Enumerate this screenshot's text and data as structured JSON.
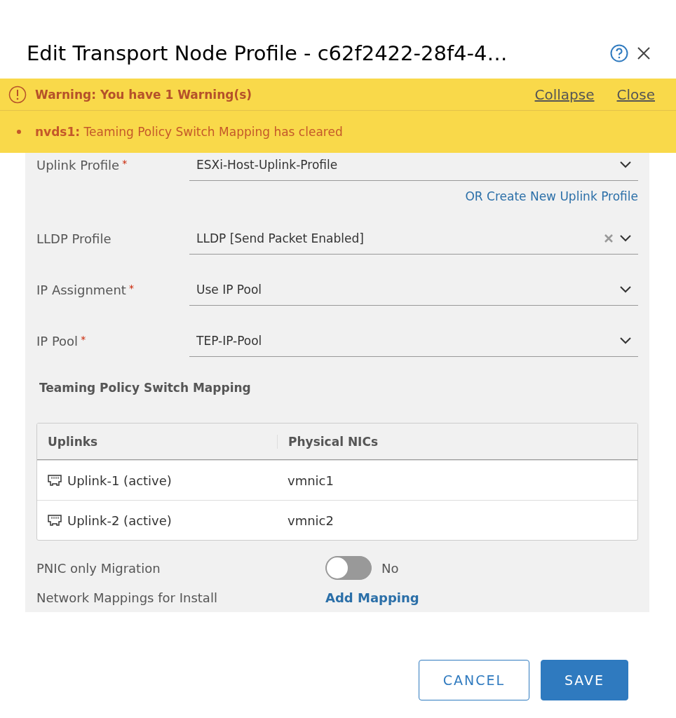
{
  "window": {
    "title": "Edit Transport Node Profile - c62f2422-28f4-4…"
  },
  "warning": {
    "title": "Warning: You have 1 Warning(s)",
    "actions": [
      "Collapse",
      "Close"
    ],
    "items": [
      {
        "source": "nvds1:",
        "message": "Teaming Policy Switch Mapping has cleared"
      }
    ]
  },
  "fields": [
    {
      "label": "Uplink Profile",
      "required_mark": "*",
      "value": "ESXi-Host-Uplink-Profile",
      "clearable": false
    },
    {
      "kind": "link",
      "label": "OR Create New Uplink Profile"
    },
    {
      "label": "LLDP Profile",
      "value": "LLDP [Send Packet Enabled]",
      "clearable": true
    },
    {
      "label": "IP Assignment",
      "required_mark": "*",
      "value": "Use IP Pool",
      "clearable": false
    },
    {
      "label": "IP Pool",
      "required_mark": "*",
      "value": "TEP-IP-Pool",
      "clearable": false
    }
  ],
  "mapping": {
    "title": "Teaming Policy Switch Mapping",
    "columns": [
      "Uplinks",
      "Physical NICs"
    ],
    "rows": [
      [
        "Uplink-1 (active)",
        "vmnic1"
      ],
      [
        "Uplink-2 (active)",
        "vmnic2"
      ]
    ]
  },
  "pnic": {
    "label": "PNIC only Migration",
    "on": false,
    "value": "No"
  },
  "network": {
    "label": "Network Mappings for Install",
    "action": "Add Mapping"
  },
  "buttons": [
    {
      "kind": "secondary",
      "label": "CANCEL"
    },
    {
      "kind": "primary",
      "label": "SAVE"
    }
  ]
}
